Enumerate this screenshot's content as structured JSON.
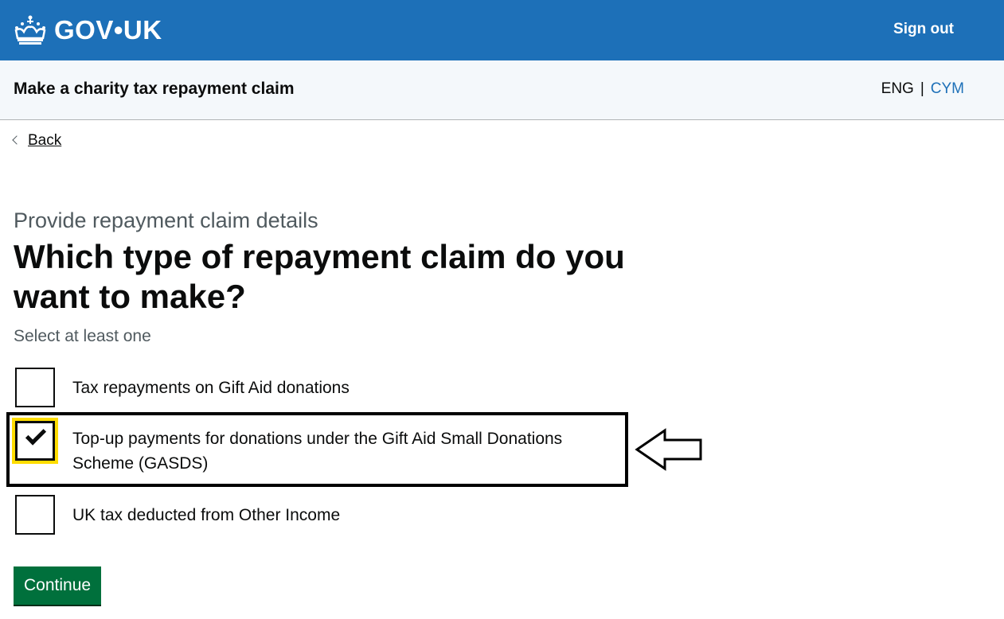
{
  "header": {
    "logo_text": "GOV•UK",
    "sign_out_label": "Sign out"
  },
  "service": {
    "name": "Make a charity tax repayment claim",
    "lang_current": "ENG",
    "lang_separator": "|",
    "lang_other": "CYM"
  },
  "back_label": "Back",
  "form": {
    "caption": "Provide repayment claim details",
    "heading": "Which type of repayment claim do you want to make?",
    "hint": "Select at least one",
    "options": [
      {
        "label": "Tax repayments on Gift Aid donations",
        "checked": false
      },
      {
        "label": "Top-up payments for donations under the Gift Aid Small Donations Scheme (GASDS)",
        "checked": true
      },
      {
        "label": "UK tax deducted from Other Income",
        "checked": false
      }
    ],
    "continue_label": "Continue"
  },
  "colors": {
    "header_blue": "#1d70b8",
    "focus_yellow": "#ffdd00",
    "button_green": "#00703c"
  }
}
